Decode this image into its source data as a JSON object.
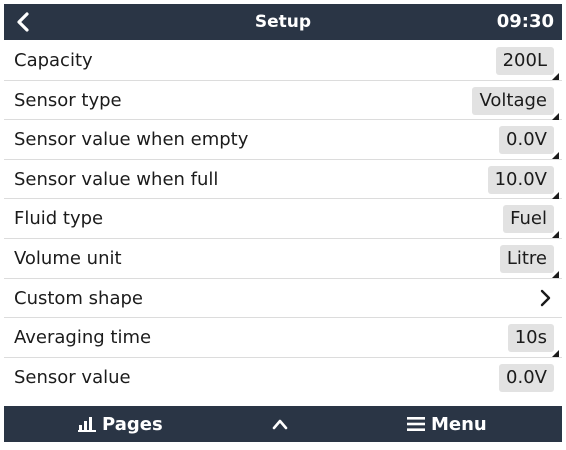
{
  "header": {
    "back_icon": "chevron-left-icon",
    "title": "Setup",
    "clock": "09:30"
  },
  "rows": [
    {
      "label": "Capacity",
      "value": "200L"
    },
    {
      "label": "Sensor type",
      "value": "Voltage"
    },
    {
      "label": "Sensor value when empty",
      "value": "0.0V"
    },
    {
      "label": "Sensor value when full",
      "value": "10.0V"
    },
    {
      "label": "Fluid type",
      "value": "Fuel"
    },
    {
      "label": "Volume unit",
      "value": "Litre"
    },
    {
      "label": "Custom shape",
      "icon": "chevron-right-icon"
    },
    {
      "label": "Averaging time",
      "value": "10s"
    },
    {
      "label": "Sensor value",
      "value": "0.0V"
    }
  ],
  "footer": {
    "pages_label": "Pages",
    "pages_icon": "bar-chart-icon",
    "up_icon": "chevron-up-icon",
    "menu_label": "Menu",
    "menu_icon": "hamburger-icon"
  },
  "colors": {
    "bar_background": "#2a3545",
    "value_box_background": "#e2e2e2"
  }
}
